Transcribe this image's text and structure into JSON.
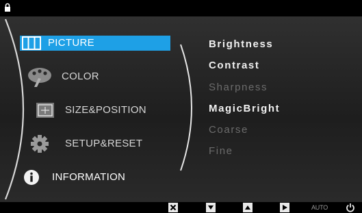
{
  "menu": {
    "items": [
      {
        "label": "PICTURE",
        "icon": "picture-icon",
        "selected": true
      },
      {
        "label": "COLOR",
        "icon": "color-palette-icon",
        "selected": false
      },
      {
        "label": "SIZE&POSITION",
        "icon": "size-position-icon",
        "selected": false
      },
      {
        "label": "SETUP&RESET",
        "icon": "gear-icon",
        "selected": false
      },
      {
        "label": "INFORMATION",
        "icon": "info-icon",
        "selected": false
      }
    ]
  },
  "submenu": {
    "items": [
      {
        "label": "Brightness",
        "enabled": true
      },
      {
        "label": "Contrast",
        "enabled": true
      },
      {
        "label": "Sharpness",
        "enabled": false
      },
      {
        "label": "MagicBright",
        "enabled": true
      },
      {
        "label": "Coarse",
        "enabled": false
      },
      {
        "label": "Fine",
        "enabled": false
      }
    ]
  },
  "bottom_bar": {
    "buttons": [
      {
        "icon": "close-icon"
      },
      {
        "icon": "down-arrow-icon"
      },
      {
        "icon": "up-arrow-icon"
      },
      {
        "icon": "enter-icon"
      }
    ],
    "auto_label": "AUTO",
    "power_icon": "power-icon"
  },
  "colors": {
    "highlight": "#1ea0e6",
    "enabled_text": "#f1f1f1",
    "disabled_text": "#6c6c6c",
    "panel": "#262626"
  }
}
